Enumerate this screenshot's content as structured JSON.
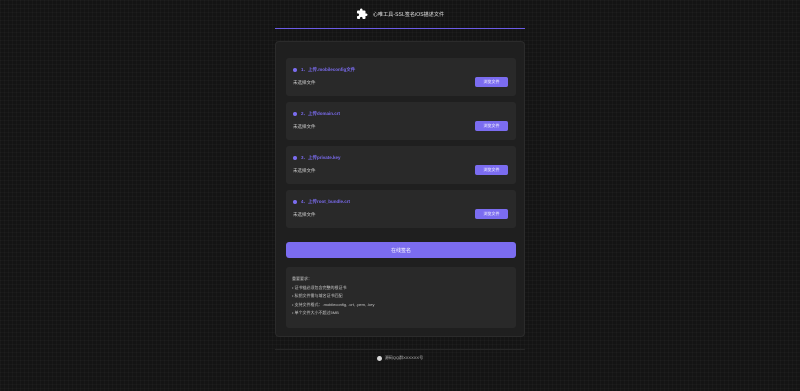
{
  "header": {
    "logo_icon": "puzzle-icon",
    "title": "心唯工具-SSL签名iOS描述文件"
  },
  "steps": [
    {
      "label": "1．上传.mobileconfig文件",
      "file_status": "未选择文件",
      "button": "浏览文件"
    },
    {
      "label": "2．上传domain.crt",
      "file_status": "未选择文件",
      "button": "浏览文件"
    },
    {
      "label": "3．上传private.key",
      "file_status": "未选择文件",
      "button": "浏览文件"
    },
    {
      "label": "4．上传root_bundle.crt",
      "file_status": "未选择文件",
      "button": "浏览文件"
    }
  ],
  "sign_button": "在线签名",
  "notes": {
    "title": "重要要求：",
    "items": [
      "• 证书链必须包含完整的根证书",
      "• 私钥文件需与域名证书匹配",
      "• 支持文件格式：.mobileconfig, .crt, .pem, .key",
      "• 单个文件大小不超过5MB"
    ]
  },
  "footer": {
    "icon": "qq-icon",
    "text": "源码QQ群XXXXXX号"
  },
  "colors": {
    "accent": "#7b6cf0",
    "background": "#141414",
    "panel": "#1f1f1f",
    "card": "#292929"
  }
}
